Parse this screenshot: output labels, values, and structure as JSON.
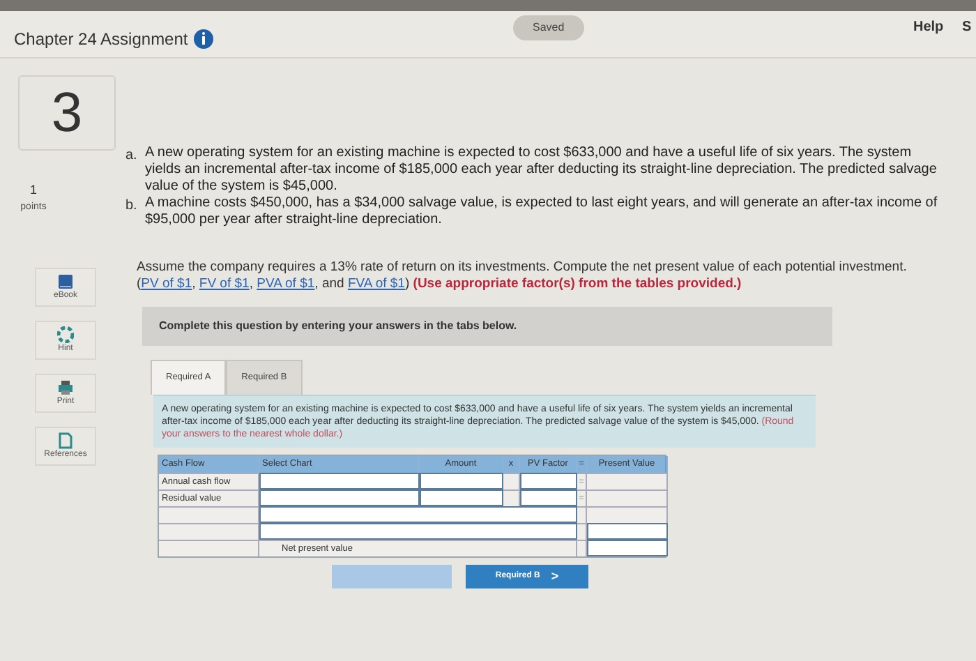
{
  "header": {
    "title": "Chapter 24 Assignment",
    "save_status": "Saved",
    "help": "Help",
    "cut_link": "S"
  },
  "question": {
    "number": "3",
    "points_value": "1",
    "points_label": "points"
  },
  "tools": [
    {
      "kind": "book",
      "label": "eBook"
    },
    {
      "kind": "hint",
      "label": "Hint"
    },
    {
      "kind": "print",
      "label": "Print"
    },
    {
      "kind": "references",
      "label": "References"
    }
  ],
  "problem_items": [
    {
      "marker": "a.",
      "text": "A new operating system for an existing machine is expected to cost $633,000 and have a useful life of six years. The system yields an incremental after-tax income of $185,000 each year after deducting its straight-line depreciation. The predicted salvage value of the system is $45,000."
    },
    {
      "marker": "b.",
      "text": "A machine costs $450,000, has a $34,000 salvage value, is expected to last eight years, and will generate an after-tax income of $95,000 per year after straight-line depreciation."
    }
  ],
  "instructions": [
    {
      "kind": "text",
      "text": "Assume the company requires a 13% rate of return on its investments. Compute the net present value of each potential investment. ("
    },
    {
      "kind": "link",
      "text": "PV of $1"
    },
    {
      "kind": "text",
      "text": ", "
    },
    {
      "kind": "link",
      "text": "FV of $1"
    },
    {
      "kind": "text",
      "text": ", "
    },
    {
      "kind": "link",
      "text": "PVA of $1"
    },
    {
      "kind": "text",
      "text": ", and "
    },
    {
      "kind": "link",
      "text": "FVA of $1"
    },
    {
      "kind": "text",
      "text": ") "
    },
    {
      "kind": "note",
      "text": "(Use appropriate factor(s) from the tables provided.)"
    }
  ],
  "banner": "Complete this question by entering your answers in the tabs below.",
  "tabs": [
    {
      "label": "Required A",
      "selected": true
    },
    {
      "label": "Required B",
      "selected": false
    }
  ],
  "prompt": {
    "text": "A new operating system for an existing machine is expected to cost $633,000 and have a useful life of six years. The system yields an incremental after-tax income of $185,000 each year after deducting its straight-line depreciation. The predicted salvage value of the system is $45,000. ",
    "note": "(Round your answers to the nearest whole dollar.)"
  },
  "table": {
    "columns": [
      "Cash Flow",
      "Select Chart",
      "Amount",
      "x",
      "PV Factor",
      "=",
      "Present Value"
    ],
    "rows": [
      {
        "kind": "entry",
        "label": "Annual cash flow",
        "operator": "="
      },
      {
        "kind": "entry",
        "label": "Residual value",
        "operator": "="
      },
      {
        "kind": "blank"
      },
      {
        "kind": "subtotal"
      },
      {
        "kind": "total",
        "label": "Net present value"
      }
    ]
  },
  "nav": {
    "previous_disabled": true,
    "next_label": "Required B",
    "next_arrow": ">"
  }
}
